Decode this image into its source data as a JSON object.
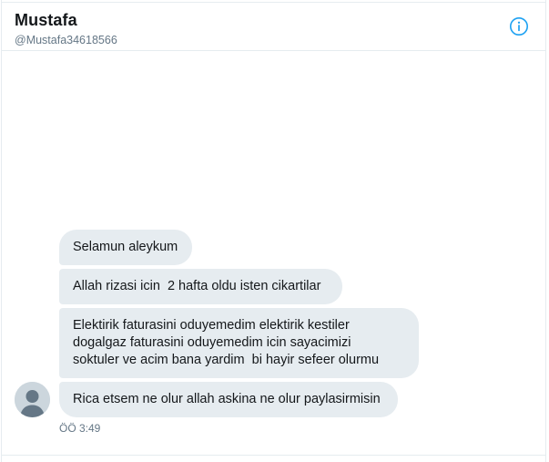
{
  "conversation_header": {
    "name": "Mustafa",
    "handle": "@Mustafa34618566",
    "info_icon": "info-circle-icon",
    "accent_color": "#1da1f2"
  },
  "messages": [
    {
      "text": "Selamun aleykum"
    },
    {
      "text": "Allah rizasi icin  2 hafta oldu isten cikartilar"
    },
    {
      "text": "Elektirik faturasini oduyemedim elektirik kestiler\ndogalgaz faturasini oduyemedim icin sayacimizi\nsoktuler ve acim bana yardim  bi hayir sefeer olurmu"
    },
    {
      "text": "Rica etsem ne olur allah askina ne olur paylasirmisin"
    }
  ],
  "sender": {
    "avatar_icon": "default-profile-avatar-icon"
  },
  "timestamp": "ÖÖ 3:49",
  "colors": {
    "bubble_background": "#e6ecf0",
    "text_primary": "#14171a",
    "text_secondary": "#657786"
  }
}
